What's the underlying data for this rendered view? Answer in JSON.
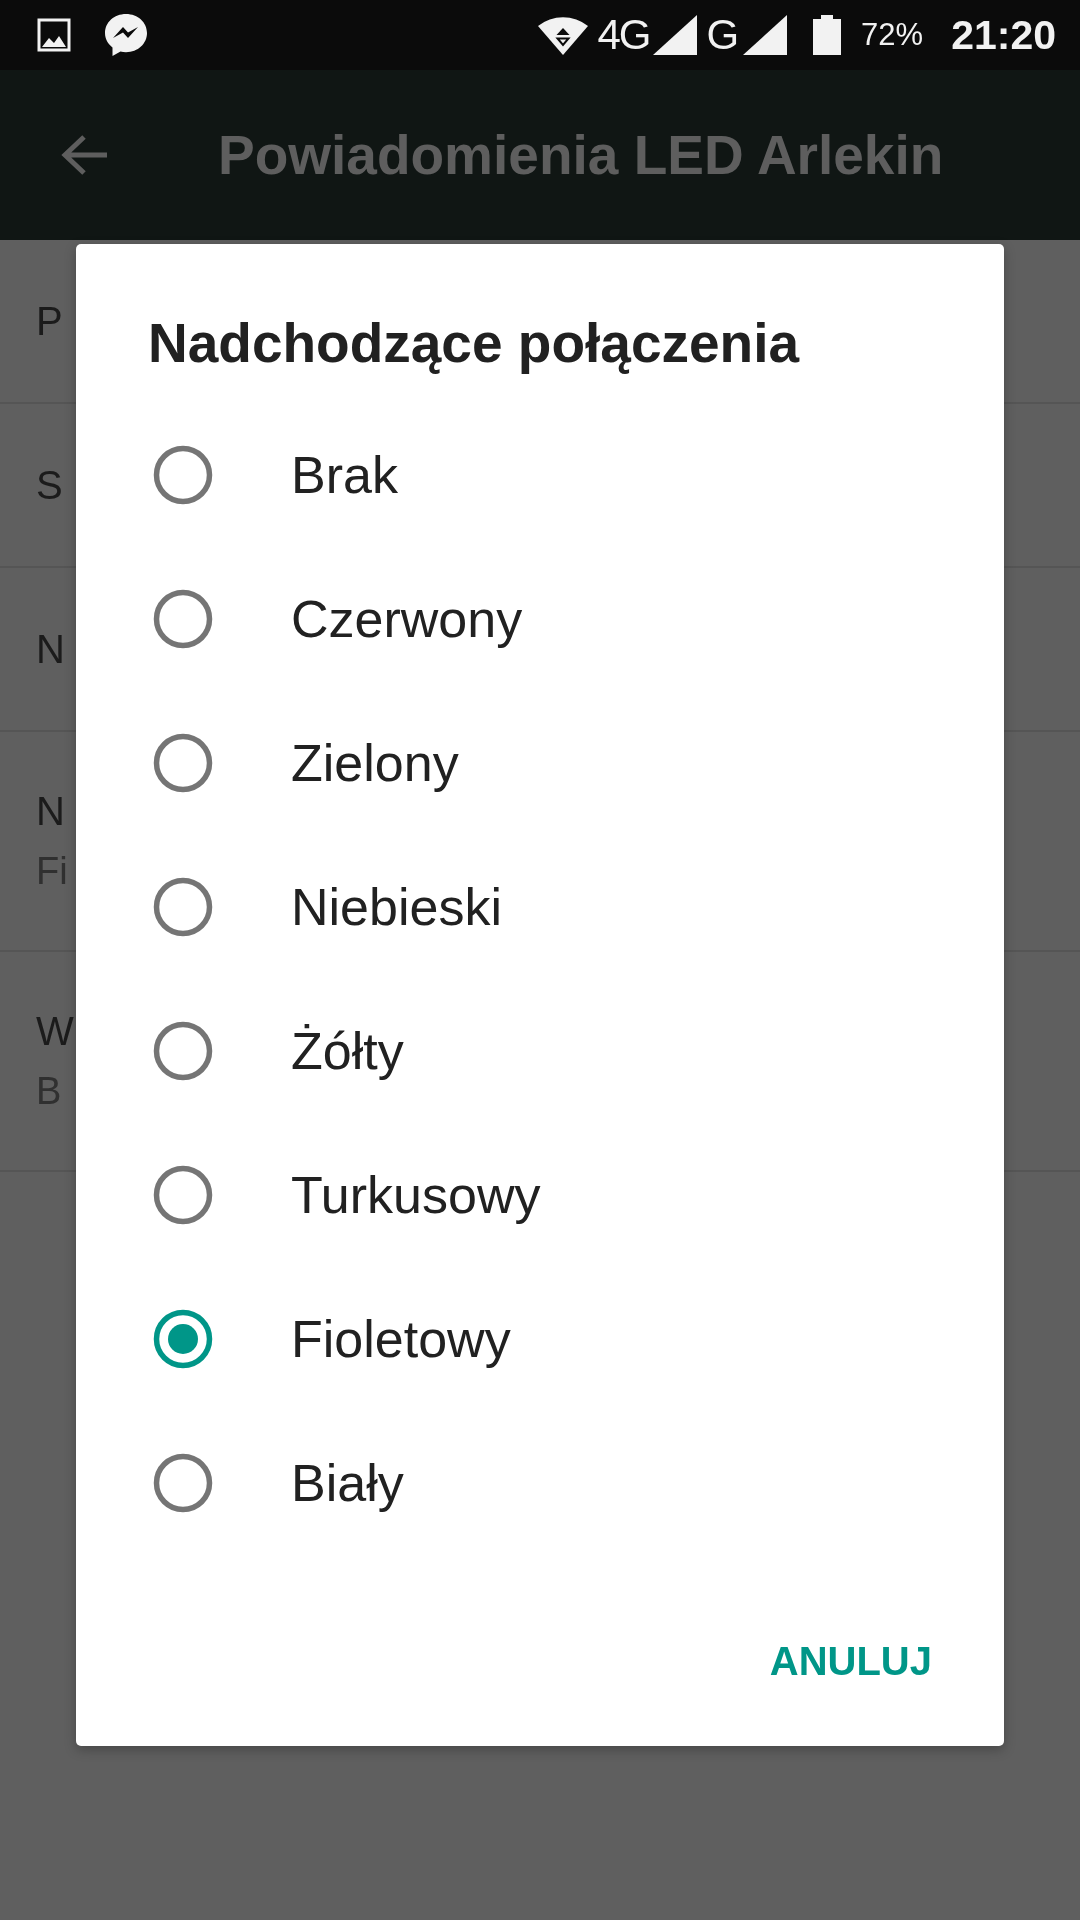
{
  "status_bar": {
    "network_1": "4G",
    "network_2": "G",
    "battery": "72%",
    "time": "21:20"
  },
  "app_bar": {
    "title": "Powiadomienia LED Arlekin"
  },
  "background_list": {
    "rows": [
      {
        "title": "P"
      },
      {
        "title": "S"
      },
      {
        "title": "N"
      },
      {
        "title": "N",
        "subtitle": "Fi"
      },
      {
        "title": "W",
        "subtitle": "B"
      }
    ]
  },
  "dialog": {
    "title": "Nadchodzące połączenia",
    "options": [
      {
        "label": "Brak",
        "selected": false
      },
      {
        "label": "Czerwony",
        "selected": false
      },
      {
        "label": "Zielony",
        "selected": false
      },
      {
        "label": "Niebieski",
        "selected": false
      },
      {
        "label": "Żółty",
        "selected": false
      },
      {
        "label": "Turkusowy",
        "selected": false
      },
      {
        "label": "Fioletowy",
        "selected": true
      },
      {
        "label": "Biały",
        "selected": false
      }
    ],
    "buttons": [
      {
        "label": "ANULUJ"
      }
    ]
  }
}
